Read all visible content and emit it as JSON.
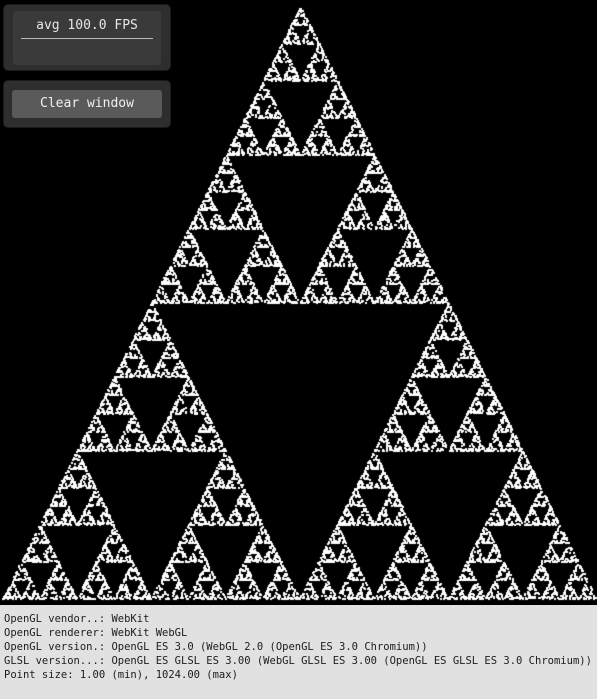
{
  "fps": {
    "label": "avg 100.0 FPS"
  },
  "controls": {
    "clear_label": "Clear window"
  },
  "canvas": {
    "background": "#000000",
    "point_color": "#ffffff",
    "figure": "sierpinski-triangle-point-cloud"
  },
  "info": {
    "lines": [
      "OpenGL vendor..: WebKit",
      "OpenGL renderer: WebKit WebGL",
      "OpenGL version.: OpenGL ES 3.0 (WebGL 2.0 (OpenGL ES 3.0 Chromium))",
      "GLSL version...: OpenGL ES GLSL ES 3.00 (WebGL GLSL ES 3.00 (OpenGL ES GLSL ES 3.0 Chromium))",
      "Point size: 1.00 (min), 1024.00 (max)"
    ]
  }
}
